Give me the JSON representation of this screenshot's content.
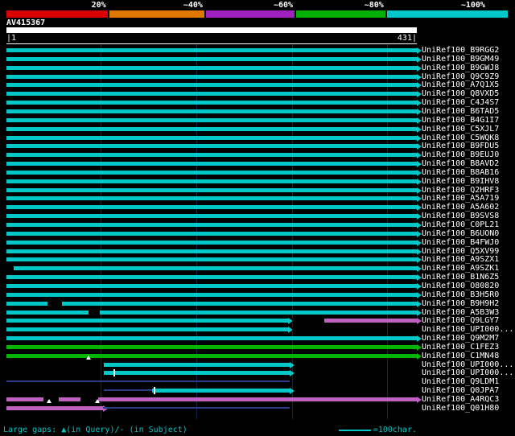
{
  "header": {
    "query_name": "AV415367",
    "coord_start": "|1",
    "coord_end": "431|"
  },
  "footer": {
    "gaps_note": "Large gaps: ▲(in Query)/- (in Subject)",
    "scale_label": "=100char."
  },
  "chart_data": {
    "type": "bar",
    "title": "AV415367",
    "x_axis": {
      "min": 1,
      "max": 431
    },
    "grid_positions": [
      100,
      200,
      300,
      400
    ],
    "legend": {
      "segments": [
        {
          "label": "20%",
          "color": "#d80000",
          "width": 20.5
        },
        {
          "label": "~40%",
          "color": "#e07800",
          "width": 19.3
        },
        {
          "label": "~60%",
          "color": "#a020c0",
          "width": 18.0
        },
        {
          "label": "~80%",
          "color": "#00b000",
          "width": 18.1
        },
        {
          "label": "~100%",
          "color": "#00c8c8",
          "width": 24.1
        }
      ]
    },
    "palette": {
      "cyan": "#00c8c8",
      "green": "#00b400",
      "pink": "#c060c0",
      "black": "#000000",
      "line": "#2c3a8a",
      "marker": "#ffffff"
    },
    "hits": [
      {
        "label": "UniRef100_B9RGG2",
        "segments": [
          {
            "s": 1,
            "e": 431,
            "c": "cyan",
            "a": 1
          }
        ]
      },
      {
        "label": "UniRef100_B9GM49",
        "segments": [
          {
            "s": 1,
            "e": 431,
            "c": "cyan",
            "a": 1
          }
        ]
      },
      {
        "label": "UniRef100_B9GWJ8",
        "segments": [
          {
            "s": 1,
            "e": 431,
            "c": "cyan",
            "a": 1
          }
        ]
      },
      {
        "label": "UniRef100_Q9C9Z9",
        "segments": [
          {
            "s": 1,
            "e": 431,
            "c": "cyan",
            "a": 1
          }
        ]
      },
      {
        "label": "UniRef100_A7Q1X5",
        "segments": [
          {
            "s": 1,
            "e": 431,
            "c": "cyan",
            "a": 1
          }
        ]
      },
      {
        "label": "UniRef100_Q8VXD5",
        "segments": [
          {
            "s": 1,
            "e": 431,
            "c": "cyan",
            "a": 1
          }
        ]
      },
      {
        "label": "UniRef100_C4J4S7",
        "segments": [
          {
            "s": 1,
            "e": 431,
            "c": "cyan",
            "a": 1
          }
        ]
      },
      {
        "label": "UniRef100_B6TAD5",
        "segments": [
          {
            "s": 1,
            "e": 431,
            "c": "cyan",
            "a": 1
          }
        ]
      },
      {
        "label": "UniRef100_B4G1I7",
        "segments": [
          {
            "s": 1,
            "e": 431,
            "c": "cyan",
            "a": 1
          }
        ]
      },
      {
        "label": "UniRef100_C5XJL7",
        "segments": [
          {
            "s": 1,
            "e": 431,
            "c": "cyan",
            "a": 1
          }
        ]
      },
      {
        "label": "UniRef100_C5WQK8",
        "segments": [
          {
            "s": 1,
            "e": 431,
            "c": "cyan",
            "a": 1
          }
        ]
      },
      {
        "label": "UniRef100_B9FDU5",
        "segments": [
          {
            "s": 1,
            "e": 431,
            "c": "cyan",
            "a": 1
          }
        ]
      },
      {
        "label": "UniRef100_B9EUJ0",
        "segments": [
          {
            "s": 1,
            "e": 431,
            "c": "cyan",
            "a": 1
          }
        ]
      },
      {
        "label": "UniRef100_B8AVD2",
        "segments": [
          {
            "s": 1,
            "e": 431,
            "c": "cyan",
            "a": 1
          }
        ]
      },
      {
        "label": "UniRef100_B8AB16",
        "segments": [
          {
            "s": 1,
            "e": 431,
            "c": "cyan",
            "a": 1
          }
        ]
      },
      {
        "label": "UniRef100_B9IHV8",
        "segments": [
          {
            "s": 1,
            "e": 431,
            "c": "cyan",
            "a": 1
          }
        ]
      },
      {
        "label": "UniRef100_Q2HRF3",
        "segments": [
          {
            "s": 1,
            "e": 431,
            "c": "cyan",
            "a": 1
          }
        ]
      },
      {
        "label": "UniRef100_A5A719",
        "segments": [
          {
            "s": 1,
            "e": 431,
            "c": "cyan",
            "a": 1
          }
        ]
      },
      {
        "label": "UniRef100_A5A602",
        "segments": [
          {
            "s": 1,
            "e": 431,
            "c": "cyan",
            "a": 1
          }
        ]
      },
      {
        "label": "UniRef100_B9SVS8",
        "segments": [
          {
            "s": 1,
            "e": 431,
            "c": "cyan",
            "a": 1
          }
        ]
      },
      {
        "label": "UniRef100_C0PL21",
        "segments": [
          {
            "s": 1,
            "e": 431,
            "c": "cyan",
            "a": 1
          }
        ]
      },
      {
        "label": "UniRef100_B6UON0",
        "segments": [
          {
            "s": 1,
            "e": 431,
            "c": "cyan",
            "a": 1
          }
        ]
      },
      {
        "label": "UniRef100_B4FWJ0",
        "segments": [
          {
            "s": 1,
            "e": 431,
            "c": "cyan",
            "a": 1
          }
        ]
      },
      {
        "label": "UniRef100_Q5XV99",
        "segments": [
          {
            "s": 1,
            "e": 431,
            "c": "cyan",
            "a": 1
          }
        ]
      },
      {
        "label": "UniRef100_A9SZX1",
        "segments": [
          {
            "s": 1,
            "e": 431,
            "c": "cyan",
            "a": 1
          }
        ]
      },
      {
        "label": "UniRef100_A9SZK1",
        "segments": [
          {
            "s": 9,
            "e": 431,
            "c": "cyan",
            "a": 1
          }
        ]
      },
      {
        "label": "UniRef100_B1N6Z5",
        "segments": [
          {
            "s": 1,
            "e": 431,
            "c": "cyan",
            "a": 1
          }
        ]
      },
      {
        "label": "UniRef100_O80820",
        "segments": [
          {
            "s": 1,
            "e": 431,
            "c": "cyan",
            "a": 1
          }
        ]
      },
      {
        "label": "UniRef100_B3H5R0",
        "segments": [
          {
            "s": 1,
            "e": 431,
            "c": "cyan",
            "a": 1
          }
        ]
      },
      {
        "label": "UniRef100_B9H9H2",
        "segments": [
          {
            "s": 1,
            "e": 44,
            "c": "cyan"
          },
          {
            "s": 44,
            "e": 59,
            "c": "black"
          },
          {
            "s": 59,
            "e": 431,
            "c": "cyan",
            "a": 1
          }
        ]
      },
      {
        "label": "UniRef100_A5B3W3",
        "segments": [
          {
            "s": 1,
            "e": 87,
            "c": "cyan"
          },
          {
            "s": 87,
            "e": 99,
            "c": "black"
          },
          {
            "s": 99,
            "e": 431,
            "c": "cyan",
            "a": 1
          }
        ]
      },
      {
        "label": "UniRef100_Q9LGY7",
        "segments": [
          {
            "s": 1,
            "e": 296,
            "c": "cyan",
            "a": 1
          },
          {
            "s": 300,
            "e": 334,
            "c": "black"
          },
          {
            "s": 334,
            "e": 431,
            "c": "pink",
            "a": 1
          }
        ]
      },
      {
        "label": "UniRef100_UPI000...",
        "segments": [
          {
            "s": 1,
            "e": 296,
            "c": "cyan",
            "a": 1
          },
          {
            "s": 300,
            "e": 337,
            "c": "black"
          }
        ]
      },
      {
        "label": "UniRef100_Q9M2M7",
        "segments": [
          {
            "s": 1,
            "e": 431,
            "c": "cyan",
            "a": 1
          }
        ]
      },
      {
        "label": "UniRef100_C1FEZ3",
        "segments": [
          {
            "s": 1,
            "e": 431,
            "c": "green",
            "a": 1
          }
        ]
      },
      {
        "label": "UniRef100_C1MN48",
        "segments": [
          {
            "s": 1,
            "e": 431,
            "c": "green",
            "a": 1
          }
        ],
        "markers": [
          {
            "p": 87,
            "t": "tri"
          }
        ]
      },
      {
        "label": "UniRef100_UPI000...",
        "segments": [
          {
            "s": 103,
            "e": 298,
            "c": "cyan",
            "a": 1
          }
        ]
      },
      {
        "label": "UniRef100_UPI000...",
        "segments": [
          {
            "s": 103,
            "e": 298,
            "c": "cyan",
            "a": 1
          }
        ],
        "markers": [
          {
            "p": 113,
            "t": "tick"
          }
        ]
      },
      {
        "label": "UniRef100_Q9LDM1",
        "segments": [
          {
            "s": 1,
            "e": 298,
            "c": "line",
            "thin": 1
          }
        ]
      },
      {
        "label": "UniRef100_Q0JPA7",
        "segments": [
          {
            "s": 103,
            "e": 154,
            "c": "line",
            "thin": 1
          },
          {
            "s": 154,
            "e": 298,
            "c": "cyan",
            "a": 1
          }
        ],
        "markers": [
          {
            "p": 155,
            "t": "tick"
          }
        ]
      },
      {
        "label": "UniRef100_A4RQC3",
        "segments": [
          {
            "s": 1,
            "e": 40,
            "c": "pink"
          },
          {
            "s": 40,
            "e": 56,
            "c": "black"
          },
          {
            "s": 56,
            "e": 79,
            "c": "pink"
          },
          {
            "s": 79,
            "e": 97,
            "c": "black"
          },
          {
            "s": 97,
            "e": 431,
            "c": "pink",
            "a": 1
          }
        ],
        "markers": [
          {
            "p": 46,
            "t": "tri"
          },
          {
            "p": 96,
            "t": "tri"
          }
        ]
      },
      {
        "label": "UniRef100_Q01H80",
        "segments": [
          {
            "s": 1,
            "e": 102,
            "c": "pink",
            "a": 1
          },
          {
            "s": 102,
            "e": 298,
            "c": "line",
            "thin": 1
          }
        ]
      }
    ]
  }
}
